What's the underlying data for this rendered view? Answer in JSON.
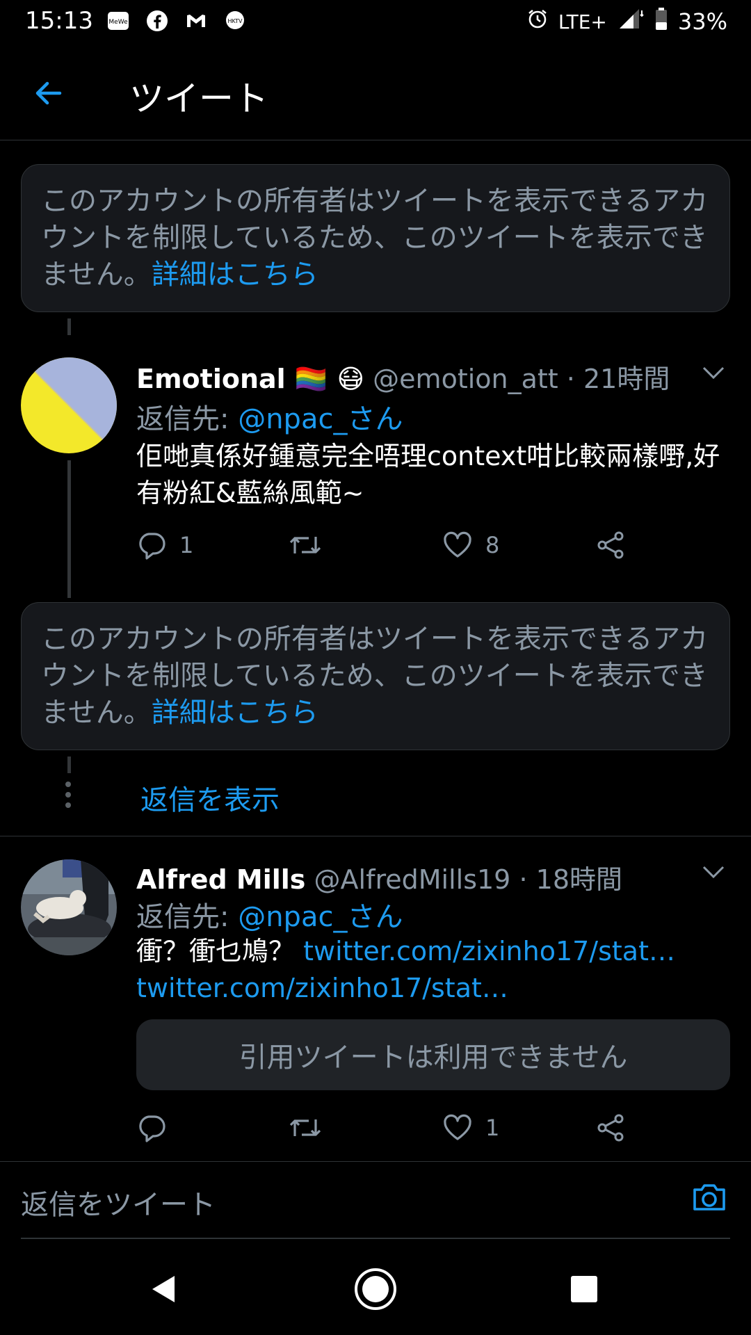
{
  "status_bar": {
    "time": "15:13",
    "network": "LTE+",
    "battery": "33%",
    "notification_icons": [
      "mewe-icon",
      "facebook-icon",
      "gmail-icon",
      "hktv-icon"
    ]
  },
  "header": {
    "title": "ツイート"
  },
  "restricted_notice": {
    "text": "このアカウントの所有者はツイートを表示できるアカウントを制限しているため、このツイートを表示できません。",
    "link": "詳細はこちら"
  },
  "tweets": [
    {
      "name": "Emotional 🏳️‍🌈 😷",
      "handle": "@emotion_att",
      "time": "21時間",
      "reply_prefix": "返信先: ",
      "reply_to": "@npac_さん",
      "body": "佢哋真係好鍾意完全唔理context咁比較兩樣嘢,好有粉紅&藍絲風範~",
      "reply_count": "1",
      "retweet_count": "",
      "like_count": "8"
    },
    {
      "name": "Alfred Mills",
      "handle": "@AlfredMills19",
      "time": "18時間",
      "reply_prefix": "返信先: ",
      "reply_to": "@npac_さん",
      "body_text": "衝？衝乜鳩？ ",
      "body_link1": "twitter.com/zixinho17/stat…",
      "body_link2": "twitter.com/zixinho17/stat…",
      "quote_unavailable": "引用ツイートは利用できません",
      "reply_count": "",
      "retweet_count": "",
      "like_count": "1"
    }
  ],
  "show_replies": "返信を表示",
  "reply_bar": {
    "placeholder": "返信をツイート"
  },
  "colors": {
    "accent": "#1d9bf0",
    "muted": "#8b98a5",
    "background": "#000000",
    "card": "#16181c"
  }
}
